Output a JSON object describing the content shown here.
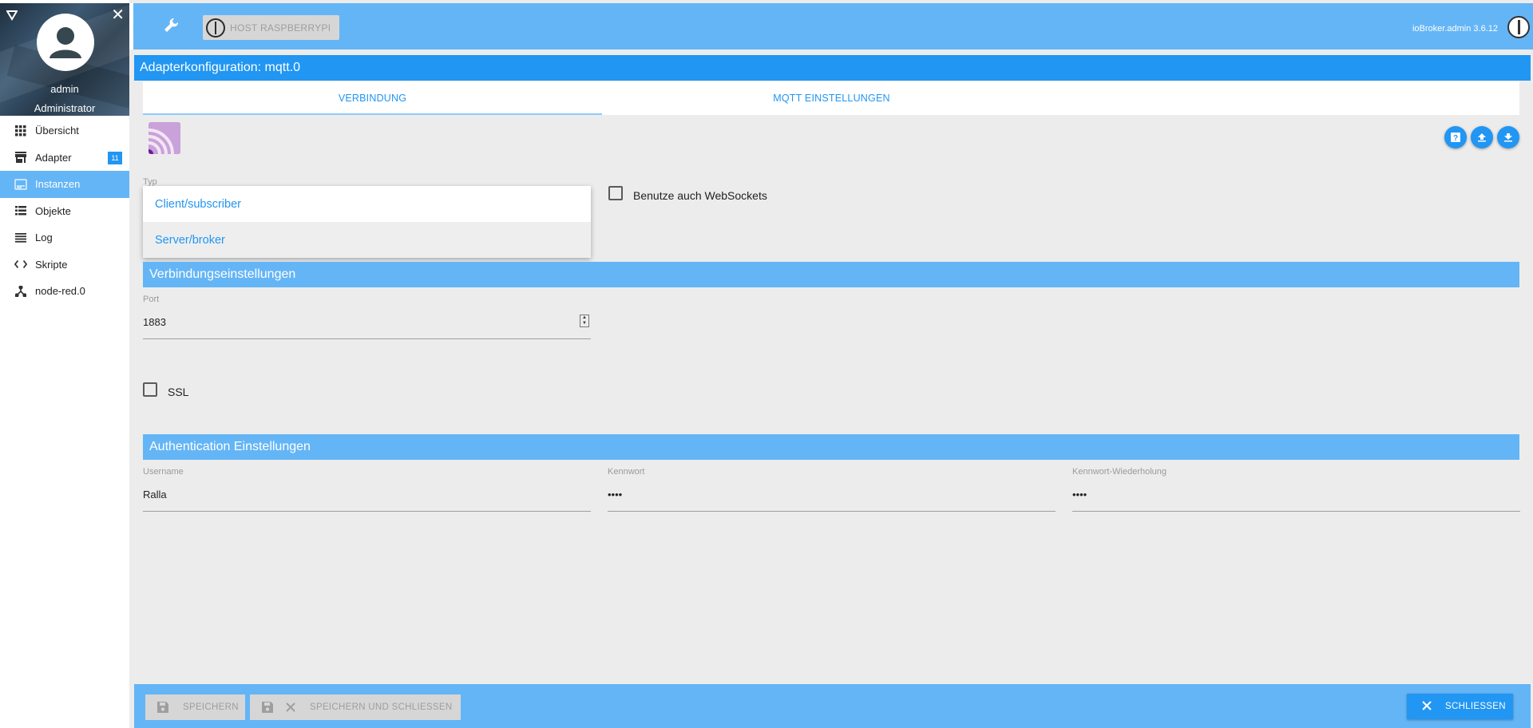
{
  "sidebar": {
    "user_name": "admin",
    "user_role": "Administrator",
    "items": [
      {
        "label": "Übersicht",
        "icon": "apps-grid-icon",
        "active": false
      },
      {
        "label": "Adapter",
        "icon": "store-icon",
        "active": false,
        "badge": "11"
      },
      {
        "label": "Instanzen",
        "icon": "instances-icon",
        "active": true
      },
      {
        "label": "Objekte",
        "icon": "list-icon",
        "active": false
      },
      {
        "label": "Log",
        "icon": "lines-icon",
        "active": false
      },
      {
        "label": "Skripte",
        "icon": "code-icon",
        "active": false
      },
      {
        "label": "node-red.0",
        "icon": "node-red-icon",
        "active": false
      }
    ]
  },
  "topbar": {
    "host_label": "HOST RASPBERRYPI",
    "version": "ioBroker.admin 3.6.12"
  },
  "page": {
    "title": "Adapterkonfiguration: mqtt.0"
  },
  "tabs": [
    {
      "label": "VERBINDUNG",
      "active": true
    },
    {
      "label": "MQTT EINSTELLUNGEN",
      "active": false
    }
  ],
  "form": {
    "typ_label": "Typ",
    "typ_options": [
      "Client/subscriber",
      "Server/broker"
    ],
    "typ_selected": "Server/broker",
    "websockets_label": "Benutze auch WebSockets",
    "websockets_checked": false,
    "connection_section": "Verbindungseinstellungen",
    "port_label": "Port",
    "port_value": "1883",
    "ssl_label": "SSL",
    "ssl_checked": false,
    "auth_section": "Authentication Einstellungen",
    "username_label": "Username",
    "username_value": "Ralla",
    "password_label": "Kennwort",
    "password_value": "••••",
    "password_repeat_label": "Kennwort-Wiederholung",
    "password_repeat_value": "••••"
  },
  "footer": {
    "save_label": "SPEICHERN",
    "save_close_label": "SPEICHERN UND SCHLIESSEN",
    "close_label": "SCHLIESSEN"
  },
  "colors": {
    "primary": "#2196f3",
    "light_primary": "#64b5f6",
    "background": "#ececec"
  }
}
